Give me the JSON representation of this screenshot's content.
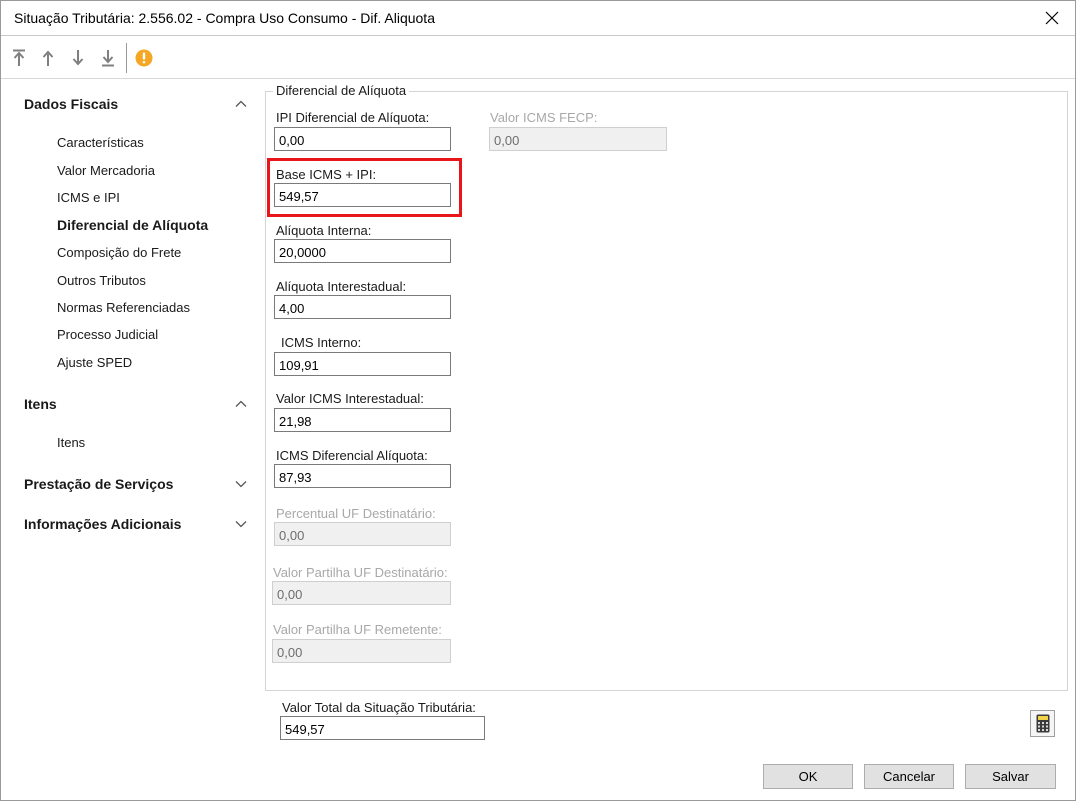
{
  "window": {
    "title": "Situação Tributária: 2.556.02 - Compra Uso Consumo - Dif. Aliquota"
  },
  "toolbar": {
    "buttons": [
      {
        "icon": "move-to-top-icon"
      },
      {
        "icon": "arrow-up-icon"
      },
      {
        "icon": "arrow-down-icon"
      },
      {
        "icon": "move-to-bottom-icon"
      },
      {
        "icon": "warning-icon",
        "color": "#f5a623"
      }
    ]
  },
  "sidebar": {
    "sections": [
      {
        "title": "Dados Fiscais",
        "expanded": true,
        "items": [
          "Características",
          "Valor Mercadoria",
          "ICMS e IPI",
          "Diferencial de Alíquota",
          "Composição do Frete",
          "Outros Tributos",
          "Normas Referenciadas",
          "Processo Judicial",
          "Ajuste SPED"
        ]
      },
      {
        "title": "Itens",
        "expanded": true,
        "items": [
          "Itens"
        ]
      },
      {
        "title": "Prestação de Serviços",
        "expanded": false,
        "items": []
      },
      {
        "title": "Informações Adicionais",
        "expanded": false,
        "items": []
      }
    ],
    "active_item": "Diferencial de Alíquota"
  },
  "group": {
    "legend": "Diferencial de Alíquota",
    "fields": {
      "ipi_dif": {
        "label": "IPI Diferencial de Alíquota:",
        "value": "0,00",
        "enabled": true
      },
      "valor_icms_fecp": {
        "label": "Valor ICMS FECP:",
        "value": "0,00",
        "enabled": false
      },
      "base_icms_ipi": {
        "label": "Base ICMS + IPI:",
        "value": "549,57",
        "enabled": true,
        "highlighted": true
      },
      "aliquota_interna": {
        "label": "Alíquota Interna:",
        "value": "20,0000",
        "enabled": true
      },
      "aliquota_interestadual": {
        "label": "Alíquota Interestadual:",
        "value": "4,00",
        "enabled": true
      },
      "icms_interno": {
        "label": "ICMS Interno:",
        "value": "109,91",
        "enabled": true
      },
      "valor_icms_interestadual": {
        "label": "Valor ICMS Interestadual:",
        "value": "21,98",
        "enabled": true
      },
      "icms_dif_aliquota": {
        "label": "ICMS Diferencial Alíquota:",
        "value": "87,93",
        "enabled": true
      },
      "percentual_uf_dest": {
        "label": "Percentual UF Destinatário:",
        "value": "0,00",
        "enabled": false
      },
      "valor_partilha_uf_dest": {
        "label": "Valor Partilha UF Destinatário:",
        "value": "0,00",
        "enabled": false
      },
      "valor_partilha_uf_rem": {
        "label": "Valor Partilha UF Remetente:",
        "value": "0,00",
        "enabled": false
      }
    }
  },
  "total": {
    "label": "Valor Total da Situação Tributária:",
    "value": "549,57"
  },
  "buttons": {
    "ok": "OK",
    "cancel": "Cancelar",
    "save": "Salvar"
  },
  "colors": {
    "highlight": "#e8151b",
    "warning": "#f5a623"
  }
}
